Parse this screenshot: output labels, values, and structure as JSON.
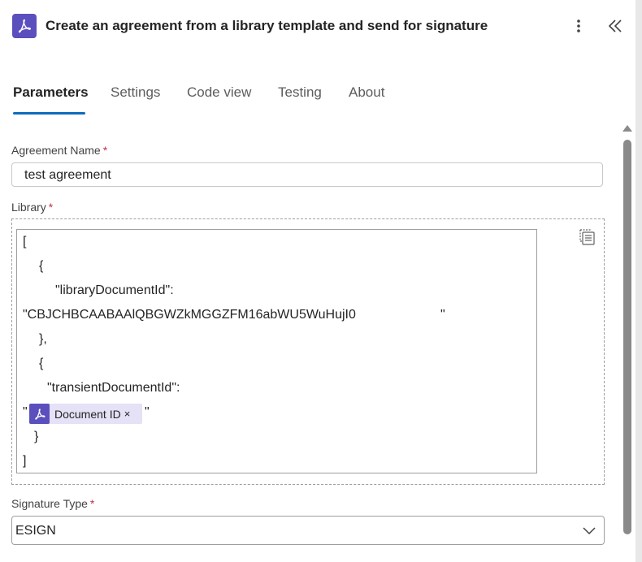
{
  "header": {
    "title": "Create an agreement from a library template and send for signature",
    "app_icon": "adobe-acrobat-sign-icon",
    "more_icon": "more-vertical-icon",
    "collapse_icon": "double-chevron-left-icon",
    "brand_color": "#5b4fbe"
  },
  "tabs": [
    {
      "label": "Parameters",
      "active": true
    },
    {
      "label": "Settings",
      "active": false
    },
    {
      "label": "Code view",
      "active": false
    },
    {
      "label": "Testing",
      "active": false
    },
    {
      "label": "About",
      "active": false
    }
  ],
  "accent_color": "#0f6cbd",
  "fields": {
    "agreement_name": {
      "label": "Agreement Name",
      "required_mark": "*",
      "value": "test agreement"
    },
    "library": {
      "label": "Library",
      "required_mark": "*",
      "lines": [
        "[",
        "{",
        "\"libraryDocumentId\":",
        "\"CBJCHBCAABAAlQBGWZkMGGZFM16abWU5WuHujI0",
        "\"",
        "},",
        "{",
        "\"transientDocumentId\":",
        "\"",
        "\"",
        "}",
        "]"
      ],
      "token": {
        "label": "Document ID",
        "close": "×",
        "icon": "adobe-acrobat-sign-icon"
      }
    },
    "signature_type": {
      "label": "Signature Type",
      "required_mark": "*",
      "value": "ESIGN"
    }
  }
}
